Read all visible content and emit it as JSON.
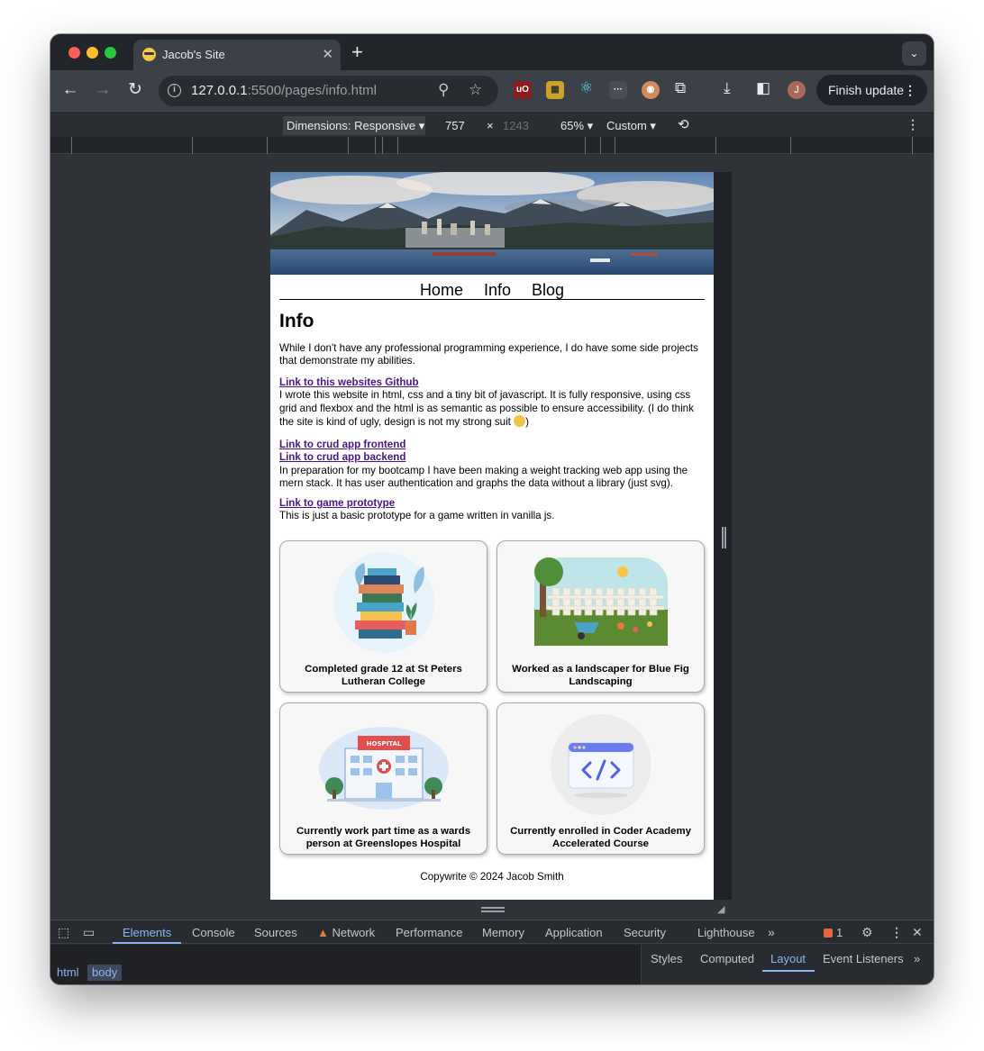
{
  "browser": {
    "tab_title": "Jacob's Site",
    "url_host": "127.0.0.1",
    "url_path": ":5500/pages/info.html",
    "avatar_initial": "J",
    "finish_update_label": "Finish update"
  },
  "device_toolbar": {
    "dimensions_label": "Dimensions: Responsive",
    "width": "757",
    "times": "×",
    "height": "1243",
    "zoom": "65%",
    "throttle": "Custom"
  },
  "site": {
    "nav": [
      "Home",
      "Info",
      "Blog"
    ],
    "heading": "Info",
    "intro": "While I don't have any professional programming experience, I do have some side projects that demonstrate my abilities.",
    "github_link": "Link to this websites Github",
    "github_desc": "I wrote this website in html, css and a tiny bit of javascript. It is fully responsive, using css grid and flexbox and the html is as semantic as possible to ensure accessibility. (I do think the site is kind of ugly, design is not my strong suit",
    "github_desc_end": ")",
    "crud_frontend_link": "Link to crud app frontend",
    "crud_backend_link": "Link to crud app backend",
    "crud_desc": "In preparation for my bootcamp I have been making a weight tracking web app using the mern stack. It has user authentication and graphs the data without a library (just svg).",
    "game_link": "Link to game prototype",
    "game_desc": "This is just a basic prototype for a game written in vanilla js.",
    "cards": [
      {
        "caption": "Completed grade 12 at St Peters Lutheran College",
        "icon": "books-icon"
      },
      {
        "caption": "Worked as a landscaper for Blue Fig Landscaping",
        "icon": "garden-icon"
      },
      {
        "caption": "Currently work part time as a wards person at Greenslopes Hospital",
        "icon": "hospital-icon"
      },
      {
        "caption": "Currently enrolled in Coder Academy Accelerated Course",
        "icon": "code-window-icon"
      }
    ],
    "footer": "Copywrite © 2024 Jacob Smith"
  },
  "devtools": {
    "tabs": [
      "Elements",
      "Console",
      "Sources",
      "Network",
      "Performance",
      "Memory",
      "Application",
      "Security",
      "Lighthouse"
    ],
    "issues_count": "1",
    "breadcrumbs": [
      "html",
      "body"
    ],
    "side_tabs": [
      "Styles",
      "Computed",
      "Layout",
      "Event Listeners"
    ]
  },
  "colors": {
    "link": "#4a1587",
    "devtools_accent": "#8ab4f8"
  }
}
